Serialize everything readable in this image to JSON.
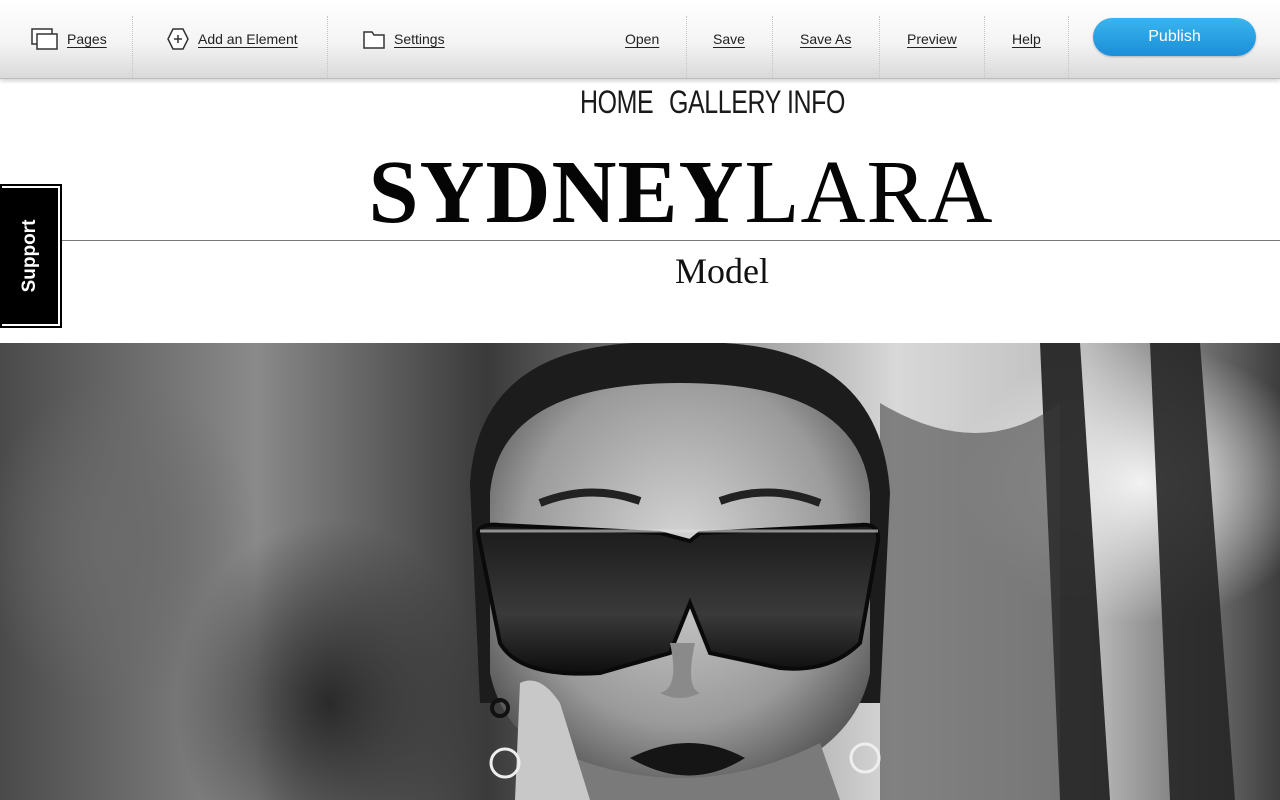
{
  "toolbar": {
    "pages_label": "Pages",
    "add_element_label": "Add an Element",
    "settings_label": "Settings",
    "open_label": "Open",
    "save_label": "Save",
    "save_as_label": "Save As",
    "preview_label": "Preview",
    "help_label": "Help",
    "publish_label": "Publish",
    "publish_color": "#1b8fd8"
  },
  "support": {
    "label": "Support"
  },
  "site": {
    "nav": [
      {
        "label": "HOME"
      },
      {
        "label": "GALLERY"
      },
      {
        "label": "INFO"
      }
    ],
    "title_bold": "SYDNEY",
    "title_regular": "LARA",
    "subtitle": "Model"
  },
  "hero": {
    "icon": "photo-model-sunglasses"
  }
}
